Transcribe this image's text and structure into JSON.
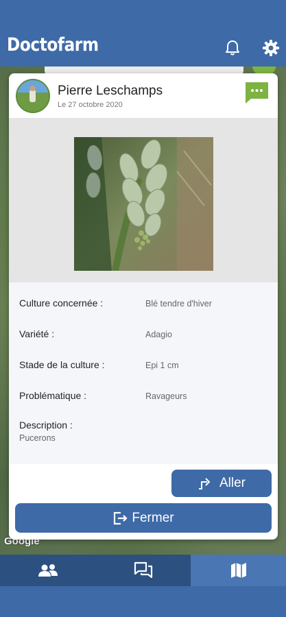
{
  "app": {
    "title": "Doctofarm"
  },
  "header": {
    "icons": [
      "bell-icon",
      "gear-icon"
    ]
  },
  "map": {
    "attribution": "Google"
  },
  "post": {
    "user_name": "Pierre Leschamps",
    "date": "Le 27 octobre 2020",
    "fields": [
      {
        "label": "Culture concernée :",
        "value": "Blé tendre d'hiver"
      },
      {
        "label": "Variété :",
        "value": "Adagio"
      },
      {
        "label": "Stade de la culture :",
        "value": "Epi 1 cm"
      },
      {
        "label": "Problématique :",
        "value": "Ravageurs"
      }
    ],
    "description_label": "Description :",
    "description_value": "Pucerons"
  },
  "actions": {
    "go_label": "Aller",
    "close_label": "Fermer"
  },
  "bottom_nav": {
    "tabs": [
      "users-icon",
      "chat-icon",
      "map-icon"
    ],
    "active": "map-icon"
  },
  "colors": {
    "primary": "#3e6aa7",
    "nav_dark": "#2c5080",
    "nav_active": "#4a76b3",
    "chat_green": "#7cb342"
  }
}
